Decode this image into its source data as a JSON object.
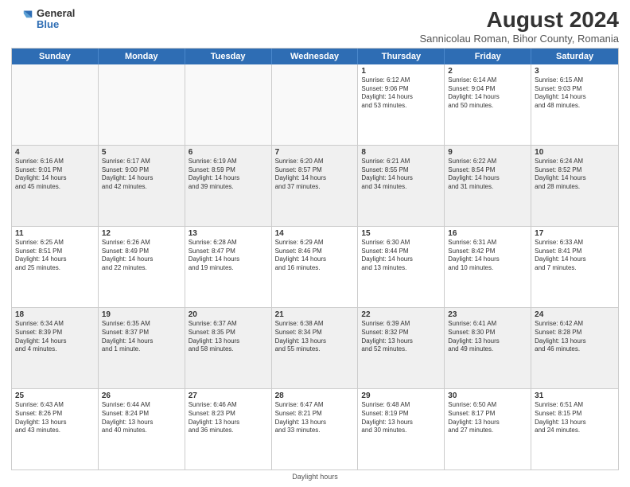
{
  "logo": {
    "general": "General",
    "blue": "Blue"
  },
  "title": "August 2024",
  "subtitle": "Sannicolau Roman, Bihor County, Romania",
  "days": [
    "Sunday",
    "Monday",
    "Tuesday",
    "Wednesday",
    "Thursday",
    "Friday",
    "Saturday"
  ],
  "footer": "Daylight hours",
  "weeks": [
    [
      {
        "day": "",
        "info": ""
      },
      {
        "day": "",
        "info": ""
      },
      {
        "day": "",
        "info": ""
      },
      {
        "day": "",
        "info": ""
      },
      {
        "day": "1",
        "info": "Sunrise: 6:12 AM\nSunset: 9:06 PM\nDaylight: 14 hours\nand 53 minutes."
      },
      {
        "day": "2",
        "info": "Sunrise: 6:14 AM\nSunset: 9:04 PM\nDaylight: 14 hours\nand 50 minutes."
      },
      {
        "day": "3",
        "info": "Sunrise: 6:15 AM\nSunset: 9:03 PM\nDaylight: 14 hours\nand 48 minutes."
      }
    ],
    [
      {
        "day": "4",
        "info": "Sunrise: 6:16 AM\nSunset: 9:01 PM\nDaylight: 14 hours\nand 45 minutes."
      },
      {
        "day": "5",
        "info": "Sunrise: 6:17 AM\nSunset: 9:00 PM\nDaylight: 14 hours\nand 42 minutes."
      },
      {
        "day": "6",
        "info": "Sunrise: 6:19 AM\nSunset: 8:59 PM\nDaylight: 14 hours\nand 39 minutes."
      },
      {
        "day": "7",
        "info": "Sunrise: 6:20 AM\nSunset: 8:57 PM\nDaylight: 14 hours\nand 37 minutes."
      },
      {
        "day": "8",
        "info": "Sunrise: 6:21 AM\nSunset: 8:55 PM\nDaylight: 14 hours\nand 34 minutes."
      },
      {
        "day": "9",
        "info": "Sunrise: 6:22 AM\nSunset: 8:54 PM\nDaylight: 14 hours\nand 31 minutes."
      },
      {
        "day": "10",
        "info": "Sunrise: 6:24 AM\nSunset: 8:52 PM\nDaylight: 14 hours\nand 28 minutes."
      }
    ],
    [
      {
        "day": "11",
        "info": "Sunrise: 6:25 AM\nSunset: 8:51 PM\nDaylight: 14 hours\nand 25 minutes."
      },
      {
        "day": "12",
        "info": "Sunrise: 6:26 AM\nSunset: 8:49 PM\nDaylight: 14 hours\nand 22 minutes."
      },
      {
        "day": "13",
        "info": "Sunrise: 6:28 AM\nSunset: 8:47 PM\nDaylight: 14 hours\nand 19 minutes."
      },
      {
        "day": "14",
        "info": "Sunrise: 6:29 AM\nSunset: 8:46 PM\nDaylight: 14 hours\nand 16 minutes."
      },
      {
        "day": "15",
        "info": "Sunrise: 6:30 AM\nSunset: 8:44 PM\nDaylight: 14 hours\nand 13 minutes."
      },
      {
        "day": "16",
        "info": "Sunrise: 6:31 AM\nSunset: 8:42 PM\nDaylight: 14 hours\nand 10 minutes."
      },
      {
        "day": "17",
        "info": "Sunrise: 6:33 AM\nSunset: 8:41 PM\nDaylight: 14 hours\nand 7 minutes."
      }
    ],
    [
      {
        "day": "18",
        "info": "Sunrise: 6:34 AM\nSunset: 8:39 PM\nDaylight: 14 hours\nand 4 minutes."
      },
      {
        "day": "19",
        "info": "Sunrise: 6:35 AM\nSunset: 8:37 PM\nDaylight: 14 hours\nand 1 minute."
      },
      {
        "day": "20",
        "info": "Sunrise: 6:37 AM\nSunset: 8:35 PM\nDaylight: 13 hours\nand 58 minutes."
      },
      {
        "day": "21",
        "info": "Sunrise: 6:38 AM\nSunset: 8:34 PM\nDaylight: 13 hours\nand 55 minutes."
      },
      {
        "day": "22",
        "info": "Sunrise: 6:39 AM\nSunset: 8:32 PM\nDaylight: 13 hours\nand 52 minutes."
      },
      {
        "day": "23",
        "info": "Sunrise: 6:41 AM\nSunset: 8:30 PM\nDaylight: 13 hours\nand 49 minutes."
      },
      {
        "day": "24",
        "info": "Sunrise: 6:42 AM\nSunset: 8:28 PM\nDaylight: 13 hours\nand 46 minutes."
      }
    ],
    [
      {
        "day": "25",
        "info": "Sunrise: 6:43 AM\nSunset: 8:26 PM\nDaylight: 13 hours\nand 43 minutes."
      },
      {
        "day": "26",
        "info": "Sunrise: 6:44 AM\nSunset: 8:24 PM\nDaylight: 13 hours\nand 40 minutes."
      },
      {
        "day": "27",
        "info": "Sunrise: 6:46 AM\nSunset: 8:23 PM\nDaylight: 13 hours\nand 36 minutes."
      },
      {
        "day": "28",
        "info": "Sunrise: 6:47 AM\nSunset: 8:21 PM\nDaylight: 13 hours\nand 33 minutes."
      },
      {
        "day": "29",
        "info": "Sunrise: 6:48 AM\nSunset: 8:19 PM\nDaylight: 13 hours\nand 30 minutes."
      },
      {
        "day": "30",
        "info": "Sunrise: 6:50 AM\nSunset: 8:17 PM\nDaylight: 13 hours\nand 27 minutes."
      },
      {
        "day": "31",
        "info": "Sunrise: 6:51 AM\nSunset: 8:15 PM\nDaylight: 13 hours\nand 24 minutes."
      }
    ]
  ]
}
